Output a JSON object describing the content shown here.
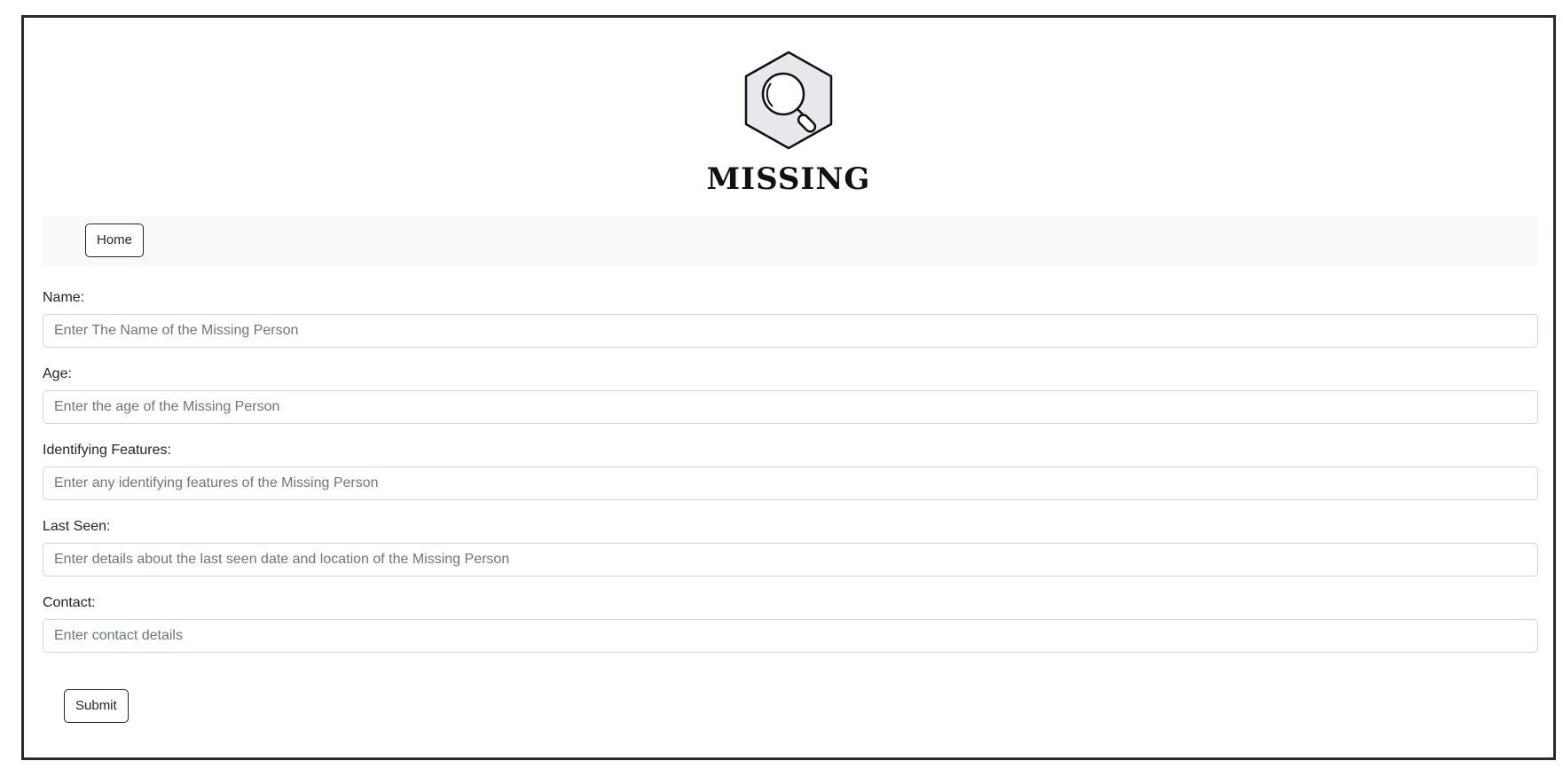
{
  "logo": {
    "text": "MISSING",
    "icon": "magnifying-glass-hexagon"
  },
  "nav": {
    "home_label": "Home"
  },
  "form": {
    "fields": [
      {
        "label": "Name:",
        "placeholder": "Enter The Name of the Missing Person"
      },
      {
        "label": "Age:",
        "placeholder": "Enter the age of the Missing Person"
      },
      {
        "label": "Identifying Features:",
        "placeholder": "Enter any identifying features of the Missing Person"
      },
      {
        "label": "Last Seen:",
        "placeholder": "Enter details about the last seen date and location of the Missing Person"
      },
      {
        "label": "Contact:",
        "placeholder": "Enter contact details"
      }
    ],
    "submit_label": "Submit"
  },
  "colors": {
    "border": "#2b2b2b",
    "navbar_bg": "#f8f9fa",
    "input_border": "#ced4da",
    "placeholder": "#6c757d"
  }
}
